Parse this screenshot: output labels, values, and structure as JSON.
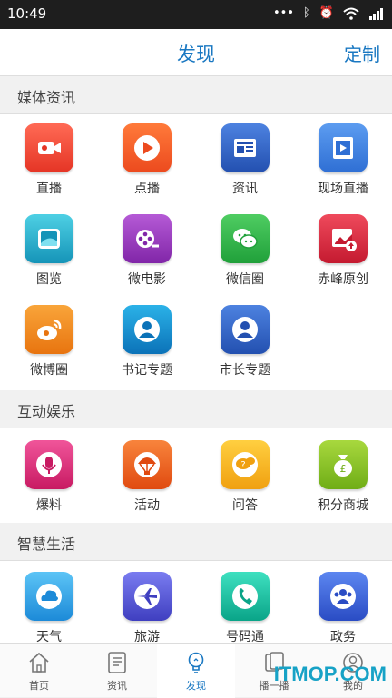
{
  "status_bar": {
    "time": "10:49",
    "icons": [
      "more-icon",
      "bluetooth-icon",
      "alarm-icon",
      "wifi-icon",
      "signal-icon"
    ]
  },
  "header": {
    "title": "发现",
    "custom": "定制"
  },
  "sections": [
    {
      "title": "媒体资讯",
      "items": [
        {
          "label": "直播",
          "icon": "video-camera-icon",
          "color": "#f04a3a"
        },
        {
          "label": "点播",
          "icon": "play-icon",
          "color": "#f35b2a"
        },
        {
          "label": "资讯",
          "icon": "newspaper-icon",
          "color": "#2f64c8"
        },
        {
          "label": "现场直播",
          "icon": "film-icon",
          "color": "#3a7fe0"
        },
        {
          "label": "图览",
          "icon": "picture-icon",
          "color": "#1aa9c6"
        },
        {
          "label": "微电影",
          "icon": "film-reel-icon",
          "color": "#9a3bbd"
        },
        {
          "label": "微信圈",
          "icon": "wechat-icon",
          "color": "#2fb44c"
        },
        {
          "label": "赤峰原创",
          "icon": "image-upload-icon",
          "color": "#d8283c"
        },
        {
          "label": "微博圈",
          "icon": "weibo-icon",
          "color": "#f08a1c"
        },
        {
          "label": "书记专题",
          "icon": "person-icon",
          "color": "#1189c9"
        },
        {
          "label": "市长专题",
          "icon": "person-icon",
          "color": "#2f64c8"
        }
      ]
    },
    {
      "title": "互动娱乐",
      "items": [
        {
          "label": "爆料",
          "icon": "microphone-icon",
          "color": "#e0317a"
        },
        {
          "label": "活动",
          "icon": "balloon-icon",
          "color": "#f0651f"
        },
        {
          "label": "问答",
          "icon": "question-bubble-icon",
          "color": "#f5b41c"
        },
        {
          "label": "积分商城",
          "icon": "money-bag-icon",
          "color": "#8cc52b"
        }
      ]
    },
    {
      "title": "智慧生活",
      "items": [
        {
          "label": "天气",
          "icon": "cloud-icon",
          "color": "#2ea6ec"
        },
        {
          "label": "旅游",
          "icon": "airplane-icon",
          "color": "#5456d6"
        },
        {
          "label": "号码通",
          "icon": "phone-icon",
          "color": "#16c2a3"
        },
        {
          "label": "政务",
          "icon": "group-icon",
          "color": "#3b63d8"
        }
      ]
    }
  ],
  "bottom_nav": [
    {
      "label": "首页",
      "icon": "home-icon"
    },
    {
      "label": "资讯",
      "icon": "document-icon"
    },
    {
      "label": "发现",
      "icon": "lightbulb-icon",
      "active": true
    },
    {
      "label": "播一播",
      "icon": "cards-icon"
    },
    {
      "label": "我的",
      "icon": "user-icon"
    }
  ],
  "watermark": "ITMOP.COM",
  "colors": {
    "accent": "#1a78c2",
    "status_bar": "#1e1e1e"
  }
}
